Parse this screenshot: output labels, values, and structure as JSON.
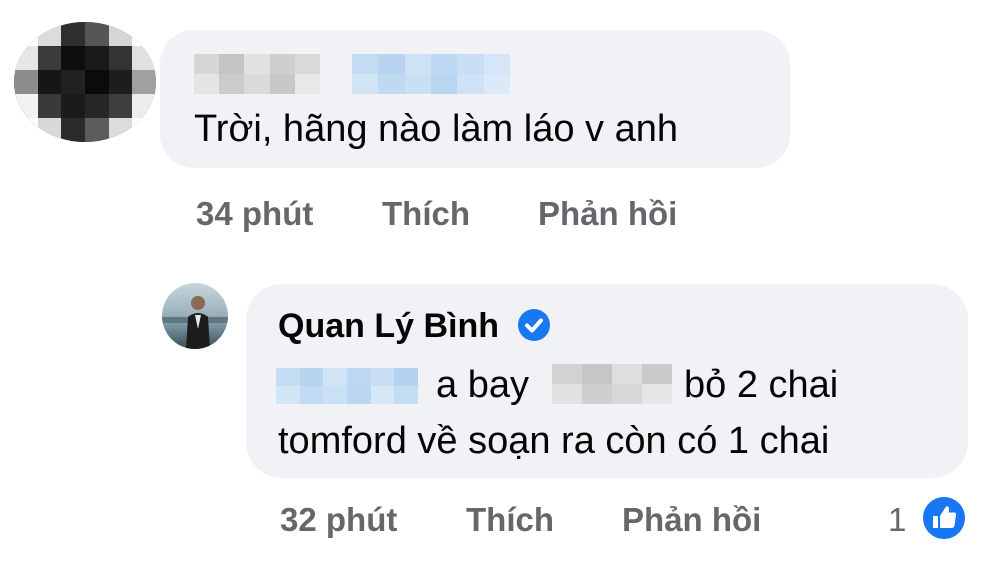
{
  "comment": {
    "text": "Trời, hãng nào làm láo v anh",
    "time": "34 phút",
    "like_label": "Thích",
    "reply_label": "Phản hồi"
  },
  "reply": {
    "author": "Quan Lý Bình",
    "line1_part1": "a bay",
    "line1_part2": "bỏ 2 chai",
    "line2": "tomford về soạn ra còn có 1 chai",
    "time": "32 phút",
    "like_label": "Thích",
    "reply_label": "Phản hồi",
    "reaction_count": "1"
  },
  "colors": {
    "bubble": "#f0f2f5",
    "meta_text": "#65676b",
    "accent": "#1877f2"
  },
  "icons": {
    "verified": "verified-badge-icon",
    "like": "thumbs-up-icon"
  }
}
